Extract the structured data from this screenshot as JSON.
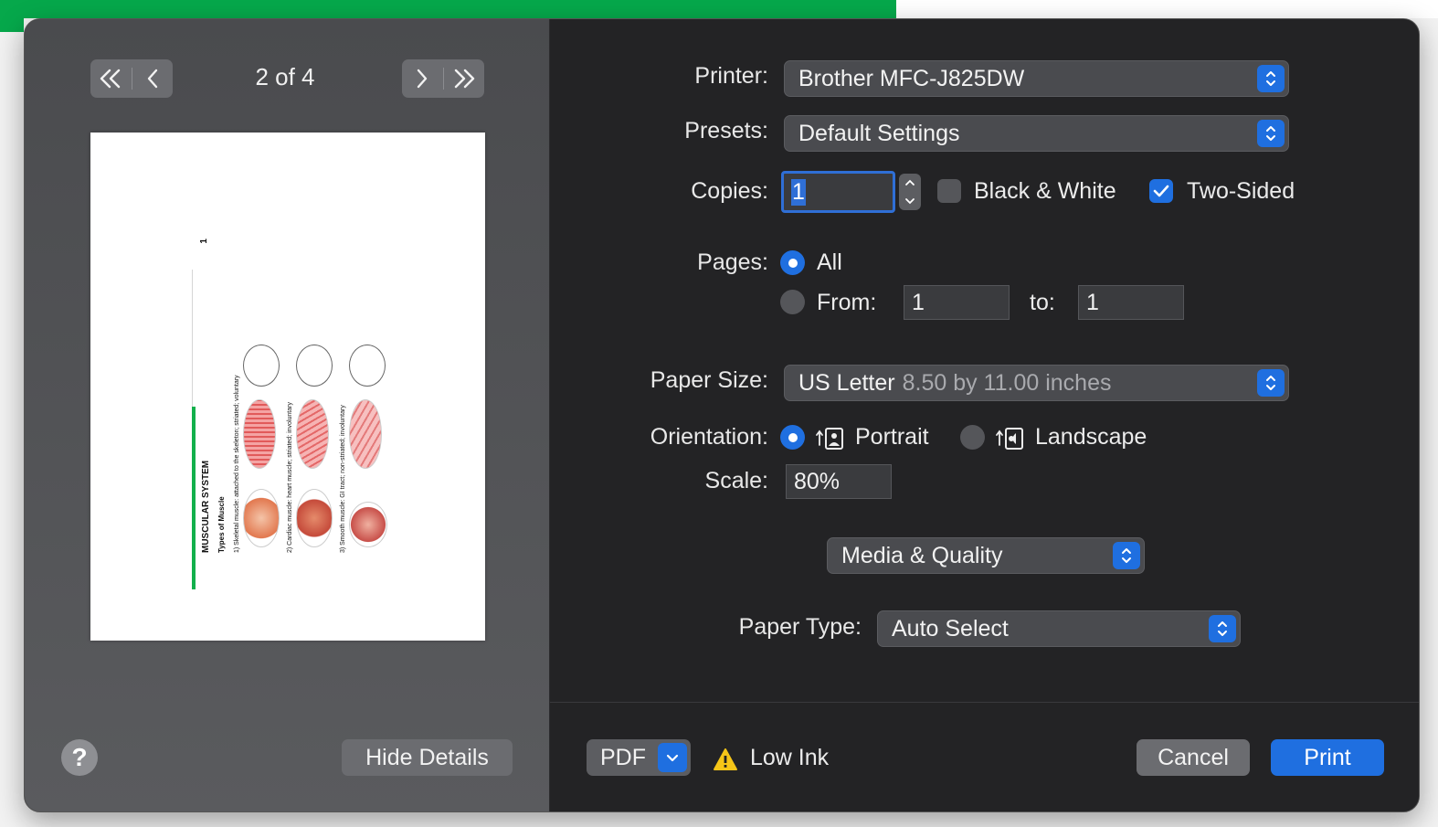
{
  "preview_nav": {
    "page_indicator": "2 of 4"
  },
  "preview_page": {
    "page_number": "1",
    "title": "MUSCULAR SYSTEM",
    "subtitle": "Types of Muscle",
    "rows": [
      "1) Skeletal muscle: attached to the skeleton; striated; voluntary",
      "2) Cardiac muscle: heart muscle; striated; involuntary",
      "3) Smooth muscle: GI tract; non-striated; involuntary"
    ]
  },
  "left_footer": {
    "hide_details_label": "Hide Details",
    "help_label": "?"
  },
  "printer": {
    "label": "Printer:",
    "value": "Brother MFC-J825DW"
  },
  "presets": {
    "label": "Presets:",
    "value": "Default Settings"
  },
  "copies": {
    "label": "Copies:",
    "value": "1",
    "black_white_label": "Black & White",
    "black_white_checked": false,
    "two_sided_label": "Two-Sided",
    "two_sided_checked": true
  },
  "pages": {
    "label": "Pages:",
    "all_label": "All",
    "from_label": "From:",
    "from_value": "1",
    "to_label": "to:",
    "to_value": "1",
    "selected": "all"
  },
  "paper_size": {
    "label": "Paper Size:",
    "value": "US Letter",
    "detail": "8.50 by 11.00 inches"
  },
  "orientation": {
    "label": "Orientation:",
    "portrait_label": "Portrait",
    "landscape_label": "Landscape",
    "selected": "portrait"
  },
  "scale": {
    "label": "Scale:",
    "value": "80%"
  },
  "section_menu": {
    "value": "Media & Quality"
  },
  "paper_type": {
    "label": "Paper Type:",
    "value": "Auto Select"
  },
  "footer": {
    "pdf_label": "PDF",
    "warning_text": "Low Ink",
    "cancel_label": "Cancel",
    "print_label": "Print"
  },
  "colors": {
    "accent": "#1f6fe0",
    "warning": "#f5c518",
    "brand_green": "#06a84b"
  }
}
